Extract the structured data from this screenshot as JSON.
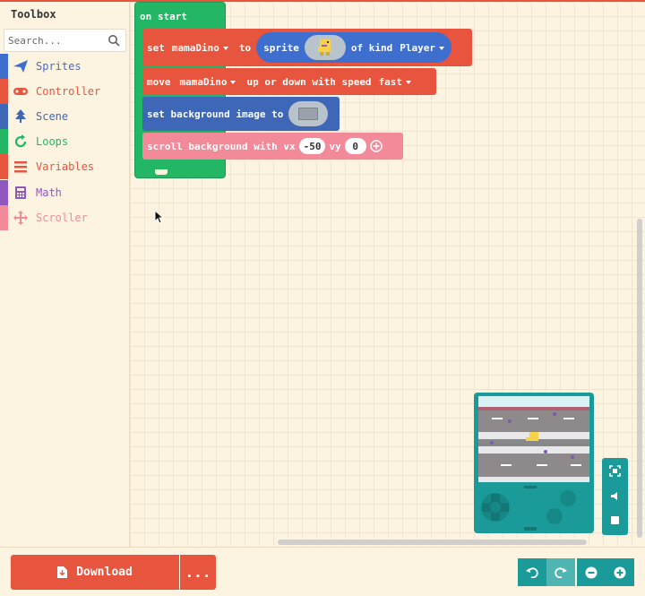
{
  "toolbox": {
    "title": "Toolbox",
    "search_placeholder": "Search...",
    "categories": [
      {
        "label": "Sprites",
        "color": "#3f6fce",
        "icon": "paper-plane-icon"
      },
      {
        "label": "Controller",
        "color": "#e8553e",
        "icon": "gamepad-icon"
      },
      {
        "label": "Scene",
        "color": "#3e67b8",
        "icon": "tree-icon"
      },
      {
        "label": "Loops",
        "color": "#23b664",
        "icon": "refresh-icon"
      },
      {
        "label": "Variables",
        "color": "#e8553e",
        "icon": "list-icon"
      },
      {
        "label": "Math",
        "color": "#8e58c0",
        "icon": "calculator-icon"
      },
      {
        "label": "Scroller",
        "color": "#f28a9a",
        "icon": "move-arrows-icon"
      }
    ]
  },
  "blocks": {
    "on_start": "on start",
    "set_row": {
      "set": "set",
      "var": "mamaDino",
      "to": "to",
      "sprite": "sprite",
      "of_kind": "of kind",
      "kind": "Player"
    },
    "move_row": {
      "move": "move",
      "var": "mamaDino",
      "mode": "up or down with speed",
      "speed": "fast"
    },
    "bg_row": {
      "label": "set background image to"
    },
    "scroll_row": {
      "label": "scroll background with vx",
      "vx": "-50",
      "vy_label": "vy",
      "vy": "0"
    }
  },
  "bottom": {
    "download": "Download",
    "more": "..."
  },
  "colors": {
    "sprites": "#3f6fce",
    "controller": "#e8553e",
    "loops": "#23b664",
    "scroller": "#f28a9a",
    "sim": "#1a9a98"
  }
}
